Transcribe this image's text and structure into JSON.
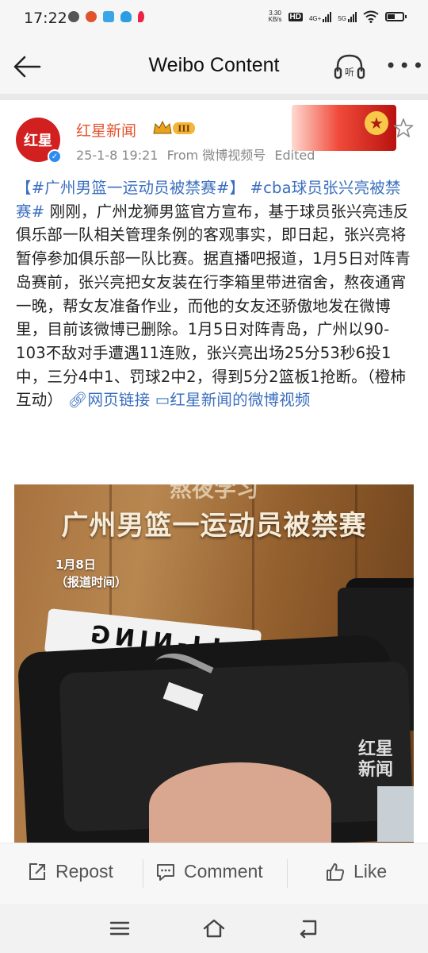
{
  "status_bar": {
    "time": "17:22",
    "speed_value": "3.30",
    "speed_unit": "KB/s",
    "hd": "HD",
    "net1": "4G+",
    "net2": "5G"
  },
  "header": {
    "title": "Weibo Content",
    "listen_label": "听"
  },
  "post": {
    "author": "红星新闻",
    "avatar_text": "红星",
    "level_badge": "III",
    "date": "25-1-8 19:21",
    "source": "From 微博视频号",
    "edited": "Edited",
    "body": {
      "tag1": "【#广州男篮一运动员被禁赛#】",
      "tag2": "#cba球员张兴亮被禁赛#",
      "text": "刚刚，广州龙狮男篮官方宣布，基于球员张兴亮违反俱乐部一队相关管理条例的客观事实，即日起，张兴亮将暂停参加俱乐部一队比赛。据直播吧报道，1月5日对阵青岛赛前，张兴亮把女友装在行李箱里带进宿舍，熬夜通宵一晚，帮女友准备作业，而他的女友还骄傲地发在微博里，目前该微博已删除。1月5日对阵青岛，广州以90-103不敌对手遭遇11连败，张兴亮出场25分53秒6投1中，三分4中1、罚球2中2，得到5分2篮板1抢断。（橙柿互动）",
      "link_label": "网页链接",
      "video_link_label": "红星新闻的微博视频"
    },
    "video": {
      "caption_top": "熬夜学习",
      "caption_main": "广州男篮一运动员被禁赛",
      "date_label": "1月8日",
      "date_note": "（报道时间）",
      "shirt_text": "LI-NING",
      "watermark": "红星新闻"
    }
  },
  "actions": {
    "repost": "Repost",
    "comment": "Comment",
    "like": "Like"
  }
}
